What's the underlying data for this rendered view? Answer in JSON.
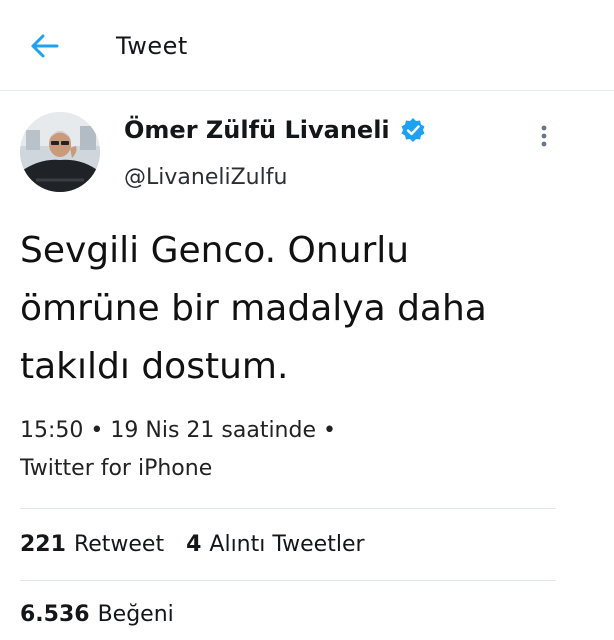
{
  "header": {
    "back_icon": "arrow-left-icon",
    "title": "Tweet",
    "accent_color": "#1DA1F2"
  },
  "tweet": {
    "author": {
      "display_name": "Ömer Zülfü Livaneli",
      "handle": "@LivaneliZulfu",
      "verified": true,
      "verified_icon": "verified-badge-icon"
    },
    "more_icon": "more-vertical-icon",
    "text_lines": [
      "Sevgili Genco.  Onurlu",
      "ömrüne bir madalya daha",
      "takıldı dostum."
    ],
    "time": "15:50",
    "date": "19 Nis 21 saatinde",
    "separator": "•",
    "source": "Twitter for iPhone"
  },
  "stats": {
    "retweets_count": "221",
    "retweets_label": "Retweet",
    "quotes_count": "4",
    "quotes_label": "Alıntı Tweetler",
    "likes_count": "6.536",
    "likes_label": "Beğeni"
  }
}
